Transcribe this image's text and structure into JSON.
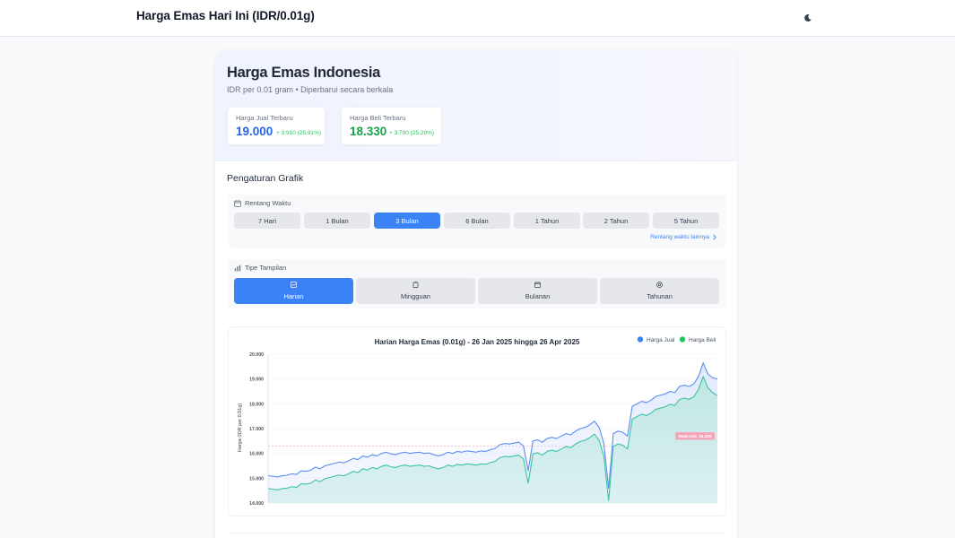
{
  "header": {
    "title": "Harga Emas Hari Ini (IDR/0.01g)",
    "theme_icon": "moon-icon"
  },
  "hero": {
    "title": "Harga Emas Indonesia",
    "subtitle": "IDR per 0.01 gram • Diperbarui secara berkala",
    "sell": {
      "label": "Harga Jual Terbaru",
      "value": "19.000",
      "change": "+ 3.910 (25.91%)"
    },
    "buy": {
      "label": "Harga Beli Terbaru",
      "value": "18.330",
      "change": "+ 3.700 (25.29%)"
    }
  },
  "settings": {
    "title": "Pengaturan Grafik",
    "range": {
      "label": "Rentang Waktu",
      "icon": "calendar-icon",
      "options": [
        "7 Hari",
        "1 Bulan",
        "3 Bulan",
        "6 Bulan",
        "1 Tahun",
        "2 Tahun",
        "5 Tahun"
      ],
      "selected": "3 Bulan",
      "more_link": "Rentang waktu lainnya"
    },
    "view": {
      "label": "Tipe Tampilan",
      "icon": "bar-chart-icon",
      "options": [
        {
          "label": "Harian",
          "icon": "chart-icon"
        },
        {
          "label": "Mingguan",
          "icon": "clipboard-icon"
        },
        {
          "label": "Bulanan",
          "icon": "calendar-icon"
        },
        {
          "label": "Tahunan",
          "icon": "at-sign-icon"
        }
      ],
      "selected": "Harian"
    }
  },
  "colors": {
    "primary": "#3b82f6",
    "sell": "#2563eb",
    "buy": "#16a34a",
    "sell_line": "#5b8def",
    "buy_line": "#3cc3a0",
    "avg_badge": "#f4a7b9"
  },
  "chart_data": {
    "type": "area",
    "title": "Harian Harga Emas (0.01g) - 26 Jan 2025 hingga 26 Apr 2025",
    "xlabel": "",
    "ylabel": "Harga (IDR per 0.01g)",
    "ylim": [
      14000,
      20000
    ],
    "yticks": [
      "14.000",
      "15.000",
      "16.000",
      "17.000",
      "18.000",
      "19.000",
      "20.000"
    ],
    "grid": true,
    "legend_position": "top-right",
    "annotation": {
      "label": "Rata-rata: 16.300",
      "y": 16300
    },
    "series": [
      {
        "name": "Harga Jual",
        "color": "#5b8def",
        "values": [
          15100,
          15080,
          15050,
          15100,
          15120,
          15180,
          15150,
          15300,
          15280,
          15320,
          15450,
          15380,
          15500,
          15550,
          15600,
          15650,
          15620,
          15700,
          15800,
          15750,
          15900,
          15850,
          15950,
          15900,
          16000,
          16050,
          15980,
          15950,
          16020,
          16050,
          16000,
          16030,
          16050,
          16000,
          16020,
          15950,
          15900,
          15950,
          16050,
          16000,
          16080,
          16050,
          16100,
          16080,
          16050,
          16100,
          16080,
          16150,
          16200,
          16350,
          16400,
          16380,
          16420,
          16450,
          16300,
          15300,
          16500,
          16550,
          16450,
          16600,
          16650,
          16600,
          16700,
          16800,
          16750,
          16900,
          17000,
          17050,
          17150,
          17300,
          17050,
          16400,
          14600,
          16800,
          16900,
          16850,
          16700,
          17900,
          18000,
          18100,
          18050,
          18150,
          18300,
          18350,
          18400,
          18500,
          18450,
          18700,
          18750,
          18700,
          18800,
          19100,
          19650,
          19200,
          19050,
          19000
        ]
      },
      {
        "name": "Harga Beli",
        "color": "#3cc3a0",
        "values": [
          14580,
          14560,
          14530,
          14580,
          14600,
          14660,
          14630,
          14780,
          14760,
          14800,
          14930,
          14860,
          14980,
          15030,
          15080,
          15130,
          15100,
          15180,
          15280,
          15230,
          15380,
          15330,
          15430,
          15380,
          15480,
          15530,
          15460,
          15430,
          15500,
          15530,
          15480,
          15510,
          15530,
          15480,
          15500,
          15430,
          15380,
          15430,
          15530,
          15480,
          15560,
          15530,
          15580,
          15560,
          15530,
          15580,
          15560,
          15630,
          15680,
          15830,
          15880,
          15860,
          15900,
          15930,
          15780,
          14800,
          15980,
          16030,
          15930,
          16080,
          16130,
          16080,
          16180,
          16280,
          16230,
          16380,
          16480,
          16530,
          16630,
          16780,
          16530,
          15880,
          14100,
          16280,
          16380,
          16330,
          16180,
          17380,
          17480,
          17580,
          17530,
          17630,
          17780,
          17830,
          17880,
          17980,
          17930,
          18180,
          18230,
          18180,
          18280,
          18580,
          19100,
          18650,
          18450,
          18330
        ]
      }
    ]
  }
}
